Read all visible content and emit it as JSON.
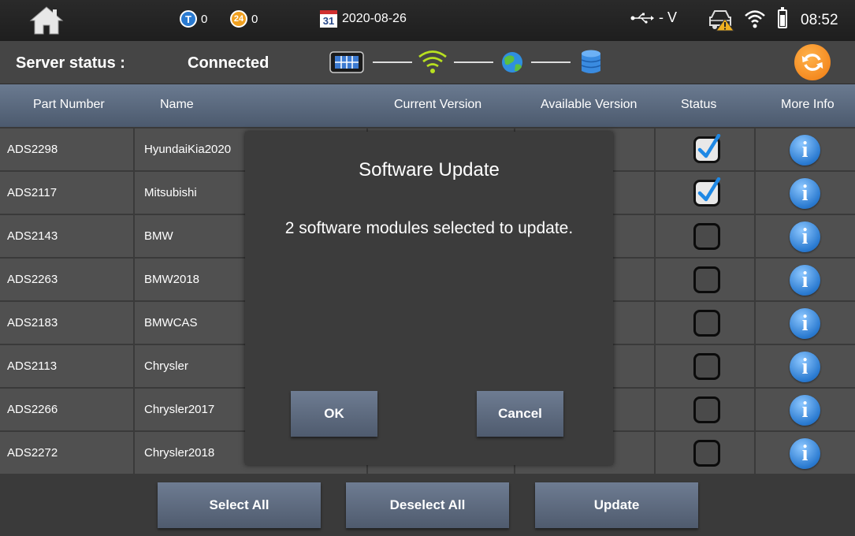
{
  "status_bar": {
    "t_count": "0",
    "t_icon_letter": "T",
    "h24_count": "0",
    "h24_icon_text": "24",
    "calendar_day": "31",
    "date": "2020-08-26",
    "voltage": "- V",
    "time": "08:52"
  },
  "server": {
    "label": "Server status :",
    "value": "Connected"
  },
  "table": {
    "headers": {
      "part_number": "Part Number",
      "name": "Name",
      "current_version": "Current Version",
      "available_version": "Available Version",
      "status": "Status",
      "more_info": "More Info"
    },
    "info_glyph": "i",
    "rows": [
      {
        "part": "ADS2298",
        "name": "HyundaiKia2020",
        "checked": true
      },
      {
        "part": "ADS2117",
        "name": "Mitsubishi",
        "checked": true
      },
      {
        "part": "ADS2143",
        "name": "BMW",
        "checked": false
      },
      {
        "part": "ADS2263",
        "name": "BMW2018",
        "checked": false
      },
      {
        "part": "ADS2183",
        "name": "BMWCAS",
        "checked": false
      },
      {
        "part": "ADS2113",
        "name": "Chrysler",
        "checked": false
      },
      {
        "part": "ADS2266",
        "name": "Chrysler2017",
        "checked": false
      },
      {
        "part": "ADS2272",
        "name": "Chrysler2018",
        "checked": false
      }
    ]
  },
  "buttons": {
    "select_all": "Select All",
    "deselect_all": "Deselect All",
    "update": "Update"
  },
  "dialog": {
    "title": "Software Update",
    "message": "2 software modules selected to update.",
    "ok": "OK",
    "cancel": "Cancel"
  },
  "colors": {
    "checkmark": "#1e88e5",
    "info": "#2a7ad0",
    "refresh": "#f08a1a"
  }
}
